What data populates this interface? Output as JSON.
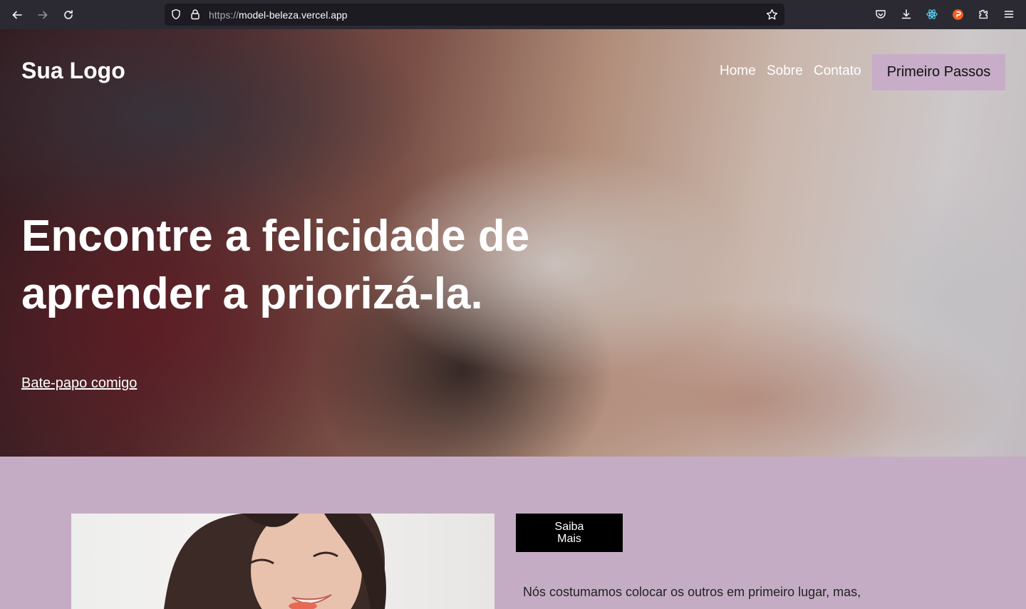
{
  "browser": {
    "url_protocol": "https://",
    "url_host": "model-beleza.vercel.app"
  },
  "header": {
    "logo": "Sua Logo",
    "nav": [
      "Home",
      "Sobre",
      "Contato"
    ],
    "cta": "Primeiro Passos"
  },
  "hero": {
    "title_line1": "Encontre a felicidade de",
    "title_line2": "aprender a priorizá-la.",
    "link": "Bate-papo comigo"
  },
  "about": {
    "button_line1": "Saiba",
    "button_line2": "Mais",
    "text": "Nós costumamos colocar os outros em primeiro lugar, mas,"
  },
  "colors": {
    "accent": "#c7adc7",
    "section_bg": "#c4adc4"
  }
}
